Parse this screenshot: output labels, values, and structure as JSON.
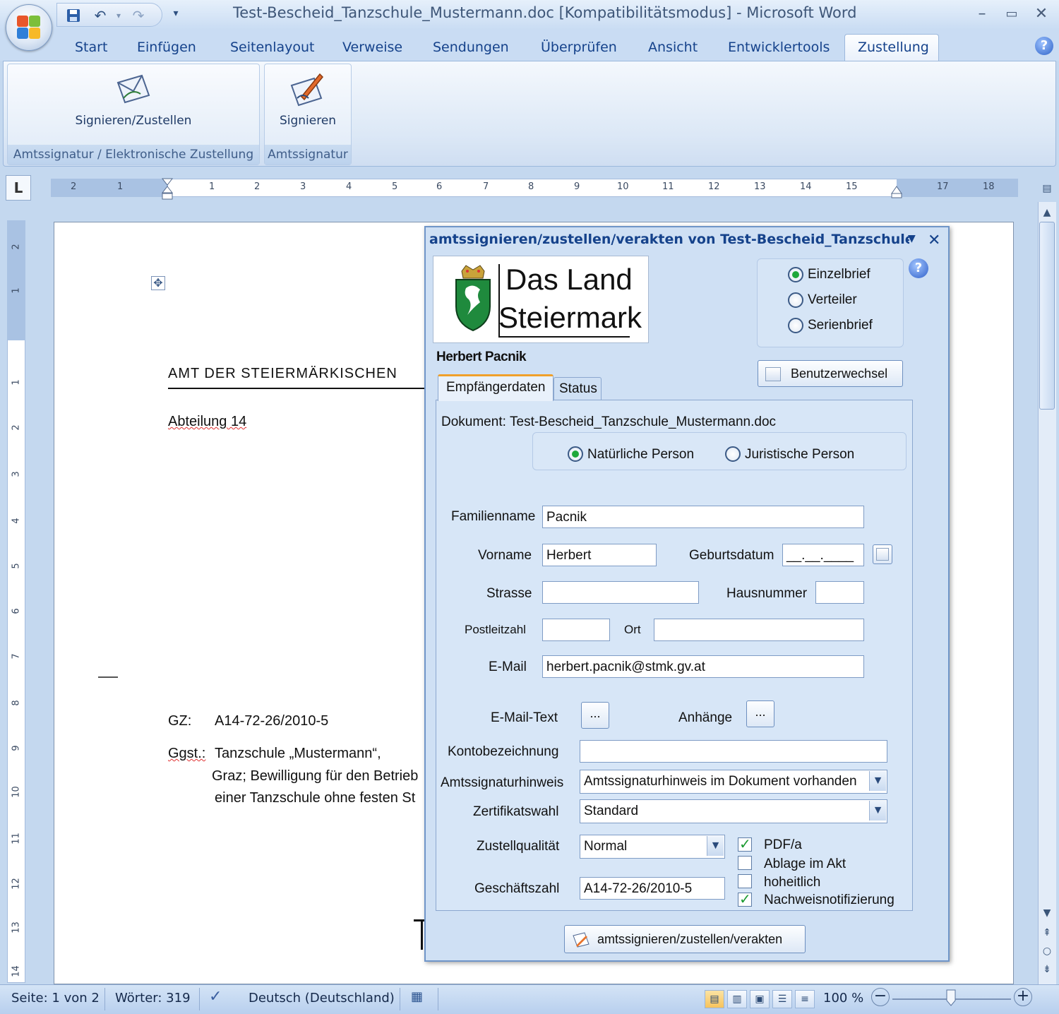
{
  "window": {
    "title": "Test-Bescheid_Tanzschule_Mustermann.doc [Kompatibilitätsmodus] - Microsoft Word",
    "minimize": "–",
    "maximize": "▭",
    "close": "✕"
  },
  "quick_access": {
    "save_icon": "save-icon",
    "undo_icon": "undo-icon",
    "redo_icon": "redo-icon",
    "customize_icon": "dropdown-icon"
  },
  "ribbon": {
    "tabs": [
      "Start",
      "Einfügen",
      "Seitenlayout",
      "Verweise",
      "Sendungen",
      "Überprüfen",
      "Ansicht",
      "Entwicklertools",
      "Zustellung"
    ],
    "active_tab": "Zustellung",
    "help": "?",
    "groups": [
      {
        "label": "Amtssignatur / Elektronische Zustellung",
        "button": "Signieren/Zustellen"
      },
      {
        "label": "Amtssignatur",
        "button": "Signieren"
      }
    ]
  },
  "ruler": {
    "corner": "L",
    "ticks": [
      "2",
      "1",
      "1",
      "2",
      "3",
      "4",
      "5",
      "6",
      "7",
      "8",
      "9",
      "10",
      "11",
      "12",
      "13",
      "14",
      "15",
      "17",
      "18"
    ],
    "vticks": [
      "2",
      "1",
      "1",
      "2",
      "3",
      "4",
      "5",
      "6",
      "7",
      "8",
      "9",
      "10",
      "11",
      "12",
      "13",
      "14"
    ]
  },
  "document": {
    "header_line": "AMT DER STEIERMÄRKISCHEN",
    "department": "Abteilung 14",
    "gz_label": "GZ:",
    "gz_value": "A14-72-26/2010-5",
    "ggst_label": "Ggst.:",
    "ggst_line1": "Tanzschule „Mustermann“,",
    "ggst_line2": "Graz; Bewilligung für den Betrieb",
    "ggst_line3": "einer Tanzschule ohne festen St"
  },
  "dialog": {
    "title": "amtssignieren/zustellen/verakten von Test-Bescheid_Tanzschule_M",
    "menu_arrow": "▼",
    "close": "✕",
    "logo_line1": "Das Land",
    "logo_line2": "Steiermark",
    "letter_types": [
      "Einzelbrief",
      "Verteiler",
      "Serienbrief"
    ],
    "selected_letter_type": "Einzelbrief",
    "help": "?",
    "user_name": "Herbert Pacnik",
    "switch_user_button": "Benutzerwechsel",
    "tabs": [
      "Empfängerdaten",
      "Status"
    ],
    "active_tab": "Empfängerdaten",
    "document_label": "Dokument:",
    "document_name": "Test-Bescheid_Tanzschule_Mustermann.doc",
    "person_types": [
      "Natürliche Person",
      "Juristische Person"
    ],
    "selected_person_type": "Natürliche Person",
    "fields": {
      "familienname_label": "Familienname",
      "familienname": "Pacnik",
      "vorname_label": "Vorname",
      "vorname": "Herbert",
      "geburtsdatum_label": "Geburtsdatum",
      "geburtsdatum": "__.__.____",
      "strasse_label": "Strasse",
      "strasse": "",
      "hausnummer_label": "Hausnummer",
      "hausnummer": "",
      "plz_label": "Postleitzahl",
      "plz": "",
      "ort_label": "Ort",
      "ort": "",
      "email_label": "E-Mail",
      "email": "herbert.pacnik@stmk.gv.at",
      "email_text_label": "E-Mail-Text",
      "email_text_button": "...",
      "anhaenge_label": "Anhänge",
      "anhaenge_button": "...",
      "konto_label": "Kontobezeichnung",
      "konto": "",
      "amtssignaturhinweis_label": "Amtssignaturhinweis",
      "amtssignaturhinweis": "Amtssignaturhinweis im Dokument vorhanden",
      "zertifikatswahl_label": "Zertifikatswahl",
      "zertifikatswahl": "Standard",
      "zustellqualitaet_label": "Zustellqualität",
      "zustellqualitaet": "Normal",
      "geschaeftszahl_label": "Geschäftszahl",
      "geschaeftszahl": "A14-72-26/2010-5"
    },
    "checkboxes": [
      {
        "label": "PDF/a",
        "checked": true
      },
      {
        "label": "Ablage im Akt",
        "checked": false
      },
      {
        "label": "hoheitlich",
        "checked": false
      },
      {
        "label": "Nachweisnotifizierung",
        "checked": true
      }
    ],
    "submit_button": "amtssignieren/zustellen/verakten"
  },
  "statusbar": {
    "page": "Seite: 1 von 2",
    "words": "Wörter: 319",
    "language": "Deutsch (Deutschland)",
    "zoom": "100 %",
    "zoom_minus": "−",
    "zoom_plus": "+"
  }
}
